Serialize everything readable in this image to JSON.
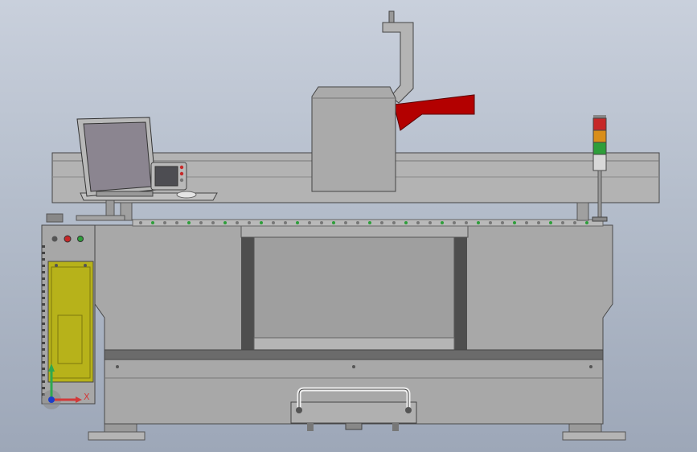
{
  "viewport": {
    "background_top": "#c9d0dc",
    "background_bottom": "#9da7b8"
  },
  "model": {
    "colors": {
      "frame": "#a8a8a8",
      "frame_dark": "#8e8e8e",
      "stripe": "#6b6b6b",
      "post": "#4e4e4e",
      "electrical_box": "#b7b21a",
      "laser_arm": "#b30000",
      "monitor_screen": "#8b8590",
      "light_red": "#c62828",
      "light_amber": "#d98e1a",
      "light_green": "#2e9e3a"
    },
    "parts": [
      "machine-base",
      "gantry-beam",
      "laser-head",
      "laser-arm",
      "monitor",
      "keyboard",
      "control-panel",
      "electrical-cabinet",
      "signal-tower",
      "handle",
      "leveling-foot-left",
      "leveling-foot-right"
    ]
  },
  "triad": {
    "x_label": "X",
    "x_color": "#d23a3a",
    "y_color": "#2fa84f",
    "origin_color": "#1c3ec9"
  }
}
